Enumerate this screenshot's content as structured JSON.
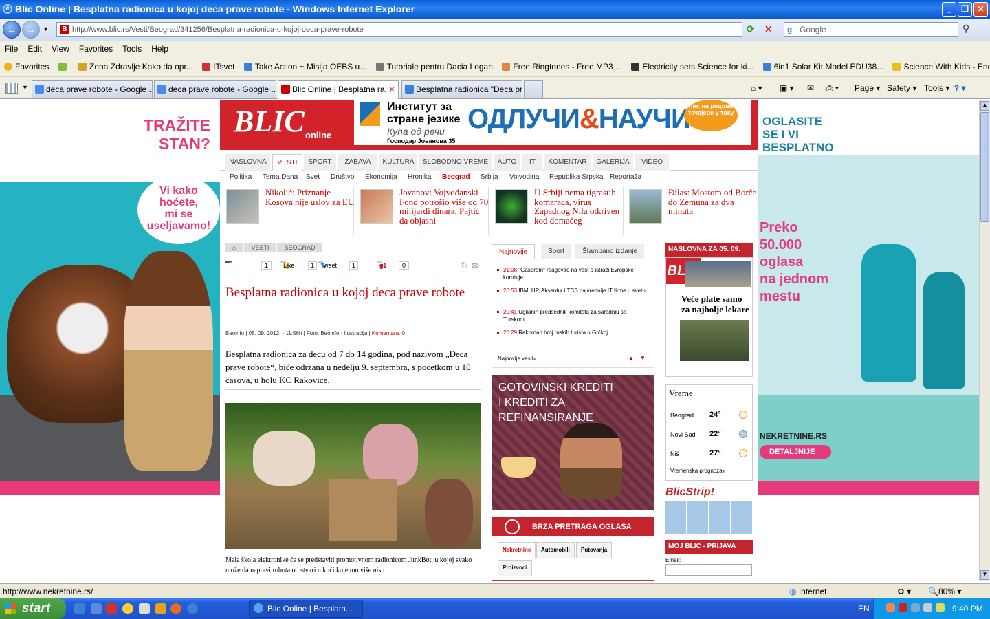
{
  "window": {
    "title": "Blic Online | Besplatna radionica u kojoj deca prave robote - Windows Internet Explorer"
  },
  "address": {
    "url": "http://www.blic.rs/Vesti/Beograd/341256/Besplatna-radionica-u-kojoj-deca-prave-robote",
    "search_placeholder": "Google"
  },
  "menu": [
    "File",
    "Edit",
    "View",
    "Favorites",
    "Tools",
    "Help"
  ],
  "favorites": {
    "label": "Favorites",
    "items": [
      "Žena  Zdravlje  Kako da opr...",
      "ITsvet",
      "Take Action ~ Misija OEBS u...",
      "Tutoriale pentru Dacia Logan",
      "Free Ringtones - Free MP3 ...",
      "Electricity sets Science for ki...",
      "6in1 Solar Kit  Model EDU38...",
      "Science With Kids - Energy ..."
    ]
  },
  "tabs": [
    {
      "label": "deca prave robote - Google ..."
    },
    {
      "label": "deca prave robote - Google ..."
    },
    {
      "label": "Blic Online | Besplatna ra..."
    },
    {
      "label": "Besplatna radionica \"Deca pr..."
    }
  ],
  "command_bar": {
    "page": "Page",
    "safety": "Safety",
    "tools": "Tools"
  },
  "left_ad": {
    "headline_1": "TRAŽITE",
    "headline_2": "STAN?",
    "bubble_1": "Vi kako",
    "bubble_2": "hoćete,",
    "bubble_3": "mi se",
    "bubble_4": "useljavamo!"
  },
  "right_ad": {
    "top_1": "OGLASITE",
    "top_2": "SE I VI",
    "top_3": "BESPLATNO",
    "big_1": "Preko",
    "big_2": "50.000",
    "big_3": "oglasa",
    "big_4": "na jednom",
    "big_5": "mestu",
    "brand": "NEKRETNINE.RS",
    "button": "DETALJNIJE"
  },
  "header": {
    "logo": "BLIC",
    "logo_sub": "online",
    "ad_line1": "Институт за",
    "ad_line2": "стране језике",
    "ad_line3": "Кућа од речи",
    "ad_line4": "Господар Јованова 35",
    "ad_big_1": "ОДЛУЧИ",
    "ad_big_2": "&",
    "ad_big_3": "НАУЧИ",
    "ad_badge": "упис на редовне течајеве у току"
  },
  "nav_main": [
    "NASLOVNA",
    "VESTI",
    "SPORT",
    "ZABAVA",
    "KULTURA",
    "SLOBODNO VREME",
    "AUTO",
    "IT",
    "KOMENTAR",
    "GALERIJA",
    "VIDEO"
  ],
  "nav_sub": [
    "Politika",
    "Tema Dana",
    "Svet",
    "Društvo",
    "Ekonomija",
    "Hronika",
    "Beograd",
    "Srbija",
    "Vojvodina",
    "Republika Srpska",
    "Reportaža"
  ],
  "headlines": [
    "Nikolić: Priznanje Kosova nije uslov za EU",
    "Jovanov: Vojvođanski Fond potrošio više od 70 milijardi dinara, Pajtić da objasni",
    "U Srbiji nema tigrastih komaraca, virus Zapadnog Nila otkriven kod domaćeg",
    "Đilas: Mostom od Borče do Zemuna za dva minuta"
  ],
  "breadcrumb": [
    "VESTI",
    "BEOGRAD"
  ],
  "social": {
    "share": "Share",
    "share_count": "1",
    "like": "Like",
    "like_count": "1",
    "tweet": "Tweet",
    "tweet_count": "1",
    "plus": "+1",
    "plus_count": "0"
  },
  "article": {
    "title": "Besplatna radionica u kojoj deca prave robote",
    "meta_source": "Beoinfo",
    "meta_date": " | 05. 09. 2012. - 11:56h | Foto: ",
    "meta_photo": "Beoinfo - Ilustracija",
    "meta_sep": " | ",
    "meta_comments": "Komentara: 0",
    "lead": "Besplatna radionica za decu od 7 do 14 godina, pod nazivom „Deca prave robote“, biće održana u nedelju 9. septembra, s početkom u 10 časova, u holu KC Rakovice.",
    "body": "Mala škola elektronike će se predstaviti promotivnom radionicom JunkBot, u kojoj svako može da napravi robota od stvari u kući koje mu više nisu"
  },
  "news_tabs": [
    "Najnovije",
    "Sport",
    "Štampano izdanje"
  ],
  "news": [
    {
      "time": "21:08",
      "text": " \"Gasprom\" reagovao na vest o istrazi Evropske komisije"
    },
    {
      "time": "20:53",
      "text": " IBM, HP, Aksentur i TCS najvrednije IT firme u svetu"
    },
    {
      "time": "20:41",
      "text": " Ugljanin predsednik komiteta za saradnju sa Turskom"
    },
    {
      "time": "20:29",
      "text": " Rekordan broj ruskih turista u Grčkoj"
    }
  ],
  "news_more": "Najnovije vesti»",
  "credit_ad": {
    "line1": "GOTOVINSKI KREDITI",
    "line2": "I KREDITI ZA",
    "line3": "REFINANSIRANJE"
  },
  "brza": {
    "title": "BRZA PRETRAGA OGLASA",
    "tabs": [
      "Nekretnine",
      "Automobili",
      "Putovanja",
      "Proizvodi"
    ]
  },
  "naslovna": {
    "title": "NASLOVNA ZA 05. 09.",
    "cover_headline": "Veće plate samo za najbolje lekare",
    "cover_logo": "BLIC"
  },
  "vreme": {
    "title": "Vreme",
    "cities": [
      {
        "city": "Beograd",
        "temp": "24°"
      },
      {
        "city": "Novi Sad",
        "temp": "22°"
      },
      {
        "city": "Niš",
        "temp": "27°"
      }
    ],
    "forecast": "Vremenska prognoza»"
  },
  "blicstrip": "BlicStrip!",
  "moj_blic": {
    "title": "MOJ BLIC - PRIJAVA",
    "email_label": "Email:"
  },
  "status": {
    "url": "http://www.nekretnine.rs/",
    "zone": "Internet",
    "zoom": "80%"
  },
  "taskbar": {
    "start": "start",
    "item": "Blic Online | Besplatn...",
    "lang": "EN",
    "clock": "9:40 PM"
  }
}
